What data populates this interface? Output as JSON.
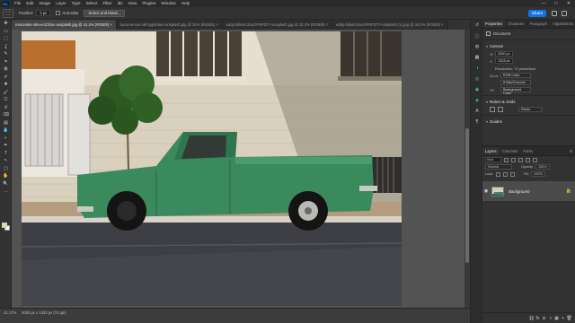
{
  "menubar": {
    "app_icon": "Ps",
    "items": [
      "File",
      "Edit",
      "Image",
      "Layer",
      "Type",
      "Select",
      "Filter",
      "3D",
      "View",
      "Plugins",
      "Window",
      "Help"
    ],
    "window_controls": [
      "—",
      "□",
      "✕"
    ]
  },
  "options": {
    "feather_label": "Feather:",
    "feather_value": "0 px",
    "antialias_label": "Anti-alias",
    "select_mask_label": "Select and Mask...",
    "share_label": "Share"
  },
  "tabs": [
    {
      "label": "mercedes-o9o-ecZ1hoc-unsplash.jpg @ 41.2% (RGB/8) ×",
      "active": true
    },
    {
      "label": "lucas-tersini-o9rhygNb5e0-unsplash.jpg @ 25% (RGB/8) ×",
      "active": false
    },
    {
      "label": "eddy-billard-3SuOFRFDTY-unsplash.jpg @ 33.3% (RGB/8) ×",
      "active": false
    },
    {
      "label": "eddy-billard-3SuOFRFDTY-unsplash (1).jpg @ 33.3% (RGB/8) ×",
      "active": false
    }
  ],
  "toolbar": {
    "tools": [
      "move-tool",
      "artboard-tool",
      "marquee-tool",
      "lasso-tool",
      "quick-selection-tool",
      "crop-tool",
      "frame-tool",
      "eyedropper-tool",
      "healing-brush-tool",
      "brush-tool",
      "clone-stamp-tool",
      "history-brush-tool",
      "eraser-tool",
      "gradient-tool",
      "blur-tool",
      "dodge-tool",
      "pen-tool",
      "type-tool",
      "path-selection-tool",
      "rectangle-tool",
      "hand-tool",
      "zoom-tool",
      "more-tools"
    ],
    "glyphs": [
      "✥",
      "▭",
      "⬚",
      "ʆ",
      "✎",
      "⌗",
      "⊠",
      "✐",
      "✚",
      "🖌",
      "⎋",
      "↺",
      "⌫",
      "▤",
      "💧",
      "◐",
      "✒",
      "T",
      "↖",
      "▢",
      "✋",
      "🔍",
      "…"
    ],
    "fg_color": "#e8d79f",
    "bg_color": "#ffffff"
  },
  "status": {
    "zoom": "41.17%",
    "info": "2000 px x 1333 px (72 ppi)"
  },
  "panel_icons": {
    "names": [
      "history-icon",
      "info-icon",
      "color-icon",
      "swatches-icon",
      "adjustments-icon",
      "libraries-icon",
      "learn-icon",
      "comments-icon",
      "character-icon",
      "paragraph-icon"
    ],
    "glyphs": [
      "↺",
      "ⓘ",
      "◍",
      "▦",
      "◑",
      "◎",
      "◉",
      "◈",
      "A",
      "¶"
    ]
  },
  "properties": {
    "tabs": [
      "Properties",
      "Character",
      "Paragraph",
      "Adjustments"
    ],
    "document_label": "Document",
    "canvas": {
      "title": "Canvas",
      "w_label": "W",
      "w_value": "2000 px",
      "h_label": "H",
      "h_value": "1333 px",
      "resolution": "Resolution: 72 pixels/inch",
      "mode_label": "Mode",
      "mode_value": "RGB Color",
      "depth_value": "8 Bits/Channel",
      "fill_label": "Fill",
      "fill_value": "Background Color"
    },
    "rulers": {
      "title": "Rulers & Grids",
      "units_value": "Pixels"
    },
    "guides": {
      "title": "Guides"
    }
  },
  "layers": {
    "tabs": [
      "Layers",
      "Channels",
      "Paths"
    ],
    "kind_label": "Kind",
    "blend_value": "Normal",
    "opacity_label": "Opacity:",
    "opacity_value": "100%",
    "lock_label": "Lock:",
    "fill_label": "Fill:",
    "fill_value": "100%",
    "items": [
      {
        "name": "Background",
        "visible": true,
        "locked": true
      }
    ],
    "footer_icons": [
      "link-icon",
      "fx-icon",
      "mask-icon",
      "adjustment-layer-icon",
      "group-icon",
      "new-layer-icon",
      "delete-icon"
    ],
    "footer_glyphs": [
      "⛓",
      "fx",
      "◘",
      "◑",
      "▣",
      "+",
      "🗑"
    ]
  }
}
